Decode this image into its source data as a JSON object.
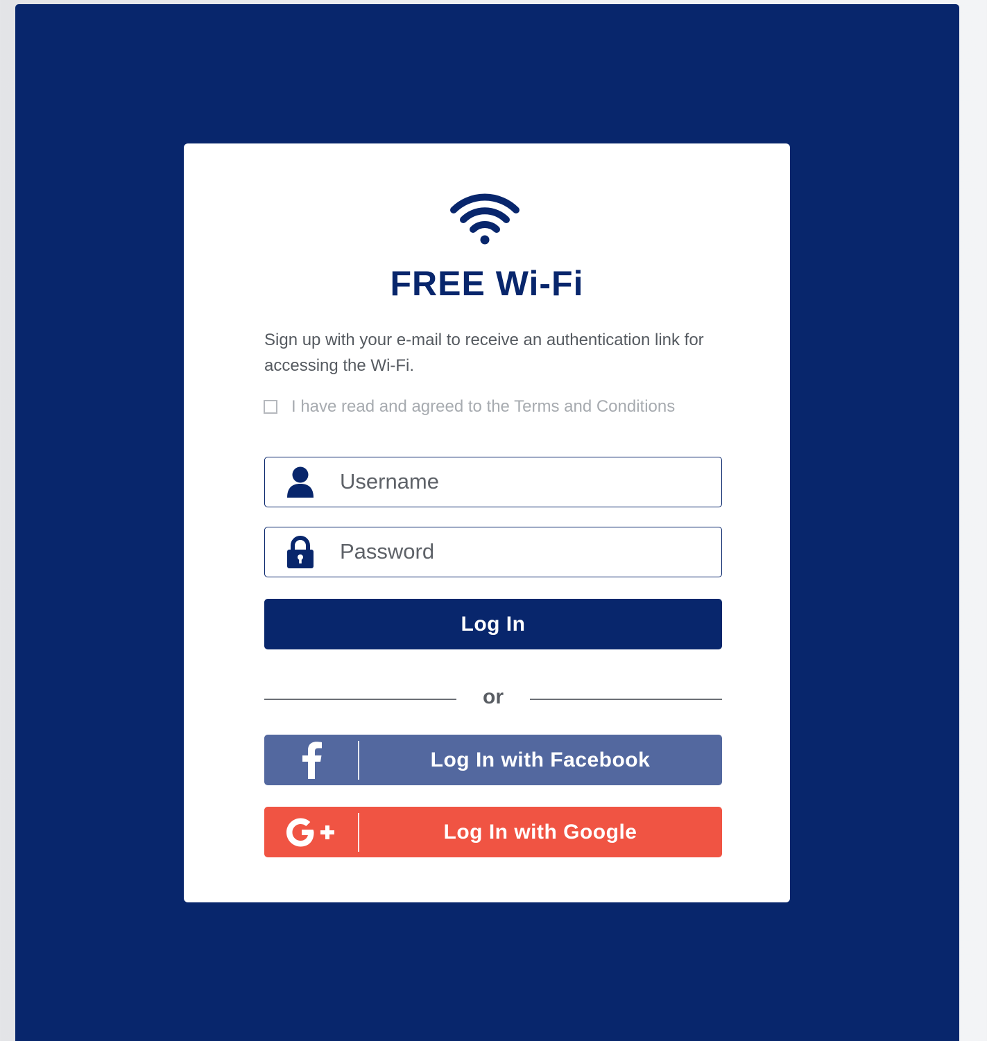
{
  "page": {
    "title": "FREE Wi-Fi",
    "description": "Sign up with your e-mail to receive an authentication link for accessing the Wi-Fi.",
    "terms_label": "I have read and agreed to the Terms and Conditions",
    "terms_checked": false
  },
  "form": {
    "username_placeholder": "Username",
    "password_placeholder": "Password",
    "login_label": "Log In",
    "separator": "or"
  },
  "social": {
    "facebook_label": "Log In with Facebook",
    "google_label": "Log In with Google"
  },
  "icons": {
    "wifi": "wifi-icon",
    "username": "user-icon",
    "password": "lock-icon",
    "facebook": "facebook-icon",
    "google": "google-plus-icon"
  },
  "colors": {
    "brand": "#08266c",
    "facebook": "#53689f",
    "google": "#f05443"
  }
}
